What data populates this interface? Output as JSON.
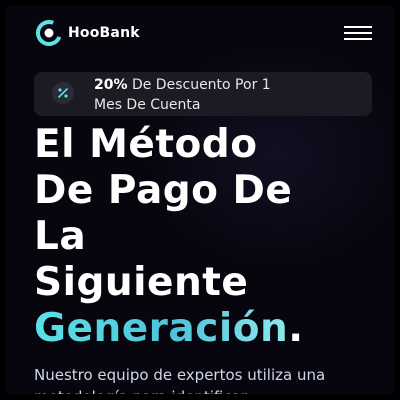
{
  "navbar": {
    "brand": "HooBank",
    "menu_icon": "hamburger-menu-icon",
    "logo_icon": "hoobank-logo-icon"
  },
  "promo": {
    "icon": "discount-icon",
    "highlight": "20%",
    "line1_rest": " De Descuento Por 1",
    "line2": "Mes De Cuenta"
  },
  "hero": {
    "lines": [
      "El Método",
      "De Pago De",
      "La",
      "Siguiente"
    ],
    "gradient_word": "Generación",
    "gradient_suffix": ".",
    "description": "Nuestro equipo de expertos utiliza una metodología para identificar"
  },
  "colors": {
    "background": "#07060f",
    "accent_cyan": "#5ce1e6",
    "promo_bg": "#1b1b23",
    "text": "#ffffff",
    "description_text": "#cfd6ea"
  }
}
